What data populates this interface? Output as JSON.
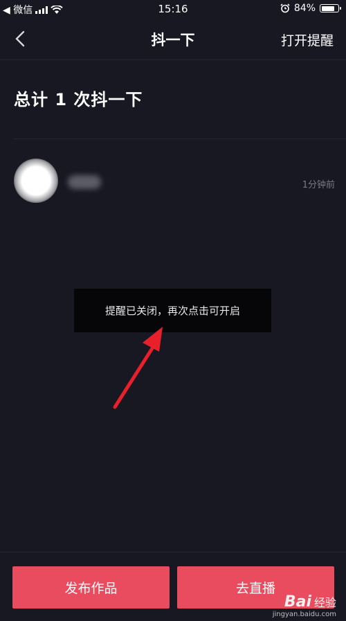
{
  "status_bar": {
    "carrier": "◀ 微信",
    "time": "15:16",
    "battery_text": "84%",
    "battery_level": 0.84
  },
  "nav": {
    "title": "抖一下",
    "action": "打开提醒",
    "back_icon": "chevron-left-icon"
  },
  "summary": {
    "total": "总计 1 次抖一下"
  },
  "list": [
    {
      "time": "1分钟前"
    }
  ],
  "toast": {
    "text": "提醒已关闭，再次点击可开启"
  },
  "buttons": {
    "publish": "发布作品",
    "live": "去直播"
  },
  "watermark": {
    "logo": "Bai",
    "logo_sub": "经验",
    "url": "jingyan.baidu.com"
  },
  "colors": {
    "background": "#181823",
    "button": "#ea4c5f",
    "arrow": "#e8202a"
  }
}
